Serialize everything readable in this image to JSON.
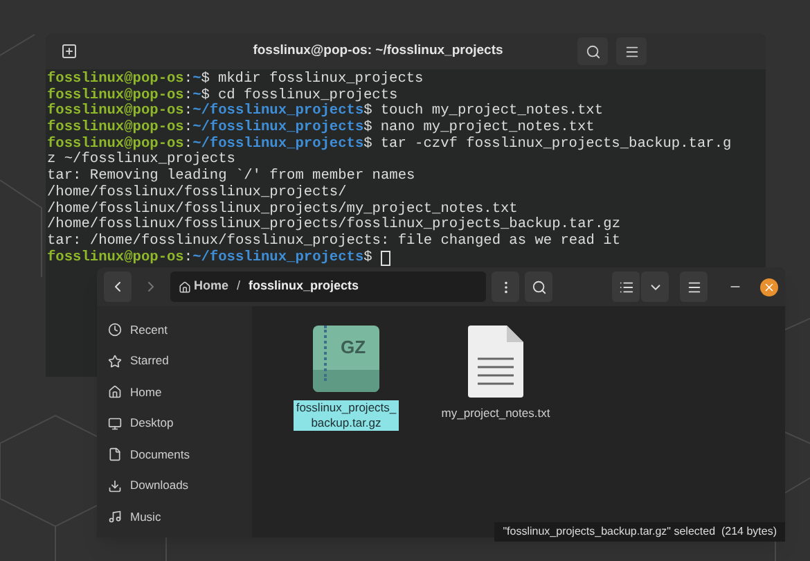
{
  "terminal": {
    "title": "fosslinux@pop-os: ~/fosslinux_projects",
    "lines": [
      {
        "kind": "prompt",
        "user": "fosslinux@pop-os",
        "sep": ":",
        "path": "~",
        "mark": "$",
        "command": "mkdir fosslinux_projects"
      },
      {
        "kind": "prompt",
        "user": "fosslinux@pop-os",
        "sep": ":",
        "path": "~",
        "mark": "$",
        "command": "cd fosslinux_projects"
      },
      {
        "kind": "prompt",
        "user": "fosslinux@pop-os",
        "sep": ":",
        "path": "~/fosslinux_projects",
        "mark": "$",
        "command": "touch my_project_notes.txt"
      },
      {
        "kind": "prompt",
        "user": "fosslinux@pop-os",
        "sep": ":",
        "path": "~/fosslinux_projects",
        "mark": "$",
        "command": "nano my_project_notes.txt"
      },
      {
        "kind": "prompt",
        "user": "fosslinux@pop-os",
        "sep": ":",
        "path": "~/fosslinux_projects",
        "mark": "$",
        "command": "tar -czvf fosslinux_projects_backup.tar.g"
      },
      {
        "kind": "output",
        "text": "z ~/fosslinux_projects"
      },
      {
        "kind": "output",
        "text": "tar: Removing leading `/' from member names"
      },
      {
        "kind": "output",
        "text": "/home/fosslinux/fosslinux_projects/"
      },
      {
        "kind": "output",
        "text": "/home/fosslinux/fosslinux_projects/my_project_notes.txt"
      },
      {
        "kind": "output",
        "text": "/home/fosslinux/fosslinux_projects/fosslinux_projects_backup.tar.gz"
      },
      {
        "kind": "output",
        "text": "tar: /home/fosslinux/fosslinux_projects: file changed as we read it"
      },
      {
        "kind": "prompt",
        "user": "fosslinux@pop-os",
        "sep": ":",
        "path": "~/fosslinux_projects",
        "mark": "$",
        "cursor": true
      }
    ]
  },
  "files": {
    "nav": {
      "back_disabled": false,
      "forward_disabled": true
    },
    "breadcrumb": {
      "home": "Home",
      "separator": "/",
      "current": "fosslinux_projects"
    },
    "sidebar": [
      {
        "label": "Recent",
        "kind": "recent",
        "selected": false
      },
      {
        "label": "Starred",
        "kind": "starred",
        "selected": false
      },
      {
        "label": "Home",
        "kind": "home",
        "selected": false
      },
      {
        "label": "Desktop",
        "kind": "desktop",
        "selected": false
      },
      {
        "label": "Documents",
        "kind": "documents",
        "selected": false
      },
      {
        "label": "Downloads",
        "kind": "downloads",
        "selected": false
      },
      {
        "label": "Music",
        "kind": "music",
        "selected": false
      }
    ],
    "items": [
      {
        "kind": "archive",
        "badge": "GZ",
        "name_lines": [
          "fosslinux_projects_",
          "backup.tar.gz"
        ],
        "selected": true
      },
      {
        "kind": "text",
        "name_lines": [
          "my_project_notes.txt"
        ],
        "selected": false
      }
    ],
    "status": "\"fosslinux_projects_backup.tar.gz\" selected  (214 bytes)"
  }
}
